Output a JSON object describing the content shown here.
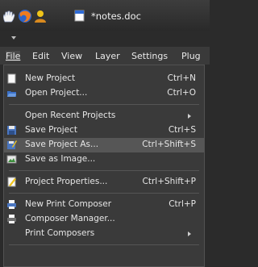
{
  "window": {
    "title": "*notes.doc"
  },
  "menubar": {
    "items": [
      "File",
      "Edit",
      "View",
      "Layer",
      "Settings",
      "Plug"
    ]
  },
  "file_menu": {
    "items": [
      {
        "label": "New Project",
        "shortcut": "Ctrl+N",
        "icon": "new-project-icon"
      },
      {
        "label": "Open Project...",
        "shortcut": "Ctrl+O",
        "icon": "open-project-icon"
      },
      {
        "label": "Open Recent Projects",
        "shortcut": "",
        "icon": ""
      },
      {
        "label": "Save Project",
        "shortcut": "Ctrl+S",
        "icon": "save-icon"
      },
      {
        "label": "Save Project As...",
        "shortcut": "Ctrl+Shift+S",
        "icon": "save-as-icon"
      },
      {
        "label": "Save as Image...",
        "shortcut": "",
        "icon": "save-image-icon"
      },
      {
        "label": "Project Properties...",
        "shortcut": "Ctrl+Shift+P",
        "icon": "properties-icon"
      },
      {
        "label": "New Print Composer",
        "shortcut": "Ctrl+P",
        "icon": "print-composer-icon"
      },
      {
        "label": "Composer Manager...",
        "shortcut": "",
        "icon": "composer-manager-icon"
      },
      {
        "label": "Print Composers",
        "shortcut": "",
        "icon": ""
      }
    ]
  },
  "colors": {
    "menu_bg": "#3a3a3a",
    "highlight": "#565656",
    "text": "#e6e6e6"
  }
}
